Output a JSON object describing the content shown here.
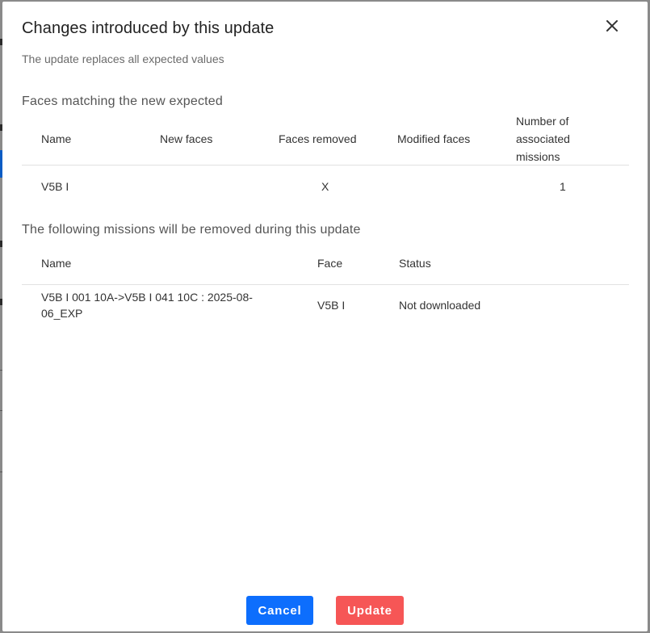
{
  "dialog": {
    "title": "Changes introduced by this update",
    "subtitle": "The update replaces all expected values",
    "close_icon": "close-icon"
  },
  "faces_section": {
    "title": "Faces matching the new expected",
    "headers": {
      "name": "Name",
      "new_faces": "New faces",
      "faces_removed": "Faces removed",
      "modified_faces": "Modified faces",
      "missions_line1": "Number of",
      "missions_line2": "associated",
      "missions_line3": "missions"
    },
    "rows": [
      {
        "name": "V5B I",
        "new_faces": "",
        "faces_removed": "X",
        "modified_faces": "",
        "missions": "1"
      }
    ]
  },
  "missions_section": {
    "title": "The following missions will be removed during this update",
    "headers": {
      "name": "Name",
      "face": "Face",
      "status": "Status"
    },
    "rows": [
      {
        "name_line1": "V5B I 001 10A->V5B I 041 10C : 2025-08-",
        "name_line2": "06_EXP",
        "face": "V5B I",
        "status": "Not downloaded"
      }
    ]
  },
  "footer": {
    "cancel_label": "Cancel",
    "update_label": "Update"
  },
  "colors": {
    "cancel": "#0d6efd",
    "update": "#f65656"
  }
}
